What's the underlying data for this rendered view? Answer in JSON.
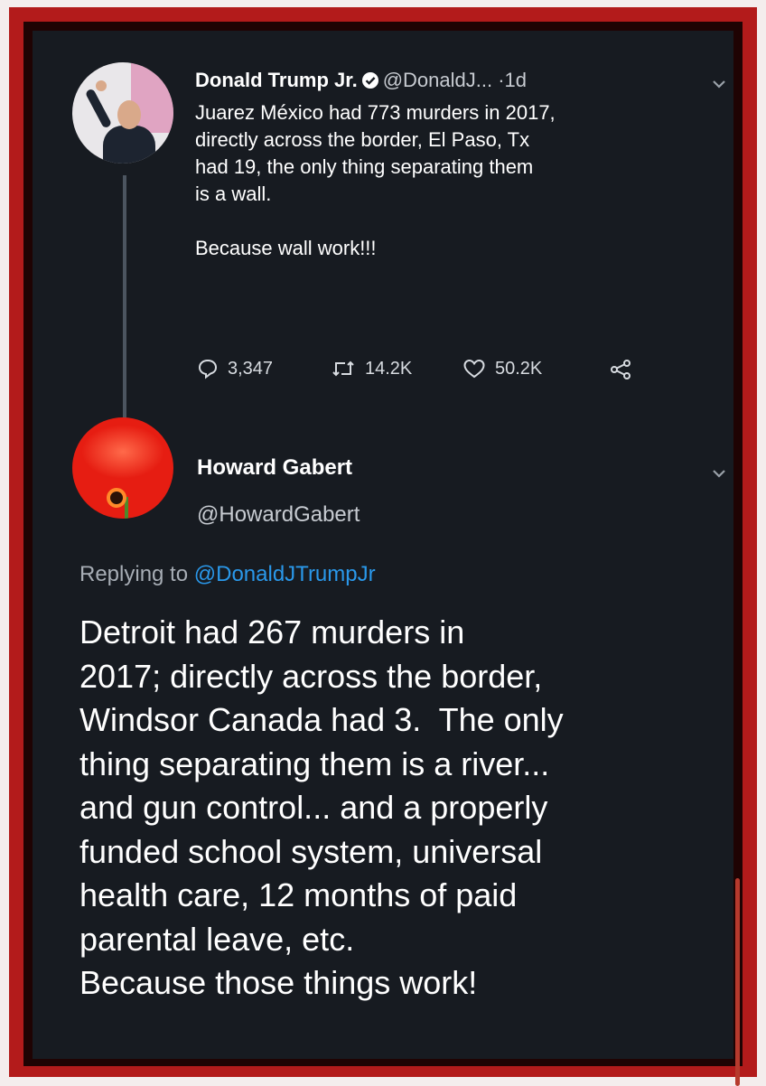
{
  "tweet1": {
    "name": "Donald Trump Jr.",
    "handle": "@DonaldJ...",
    "dot": "·",
    "time": "1d",
    "lines": [
      "Juarez México had 773 murders in 2017,",
      "directly across the border, El Paso, Tx",
      "had 19, the only thing separating them",
      "is a wall."
    ],
    "second_paragraph": "Because wall work!!!",
    "replies": "3,347",
    "retweets": "14.2K",
    "likes": "50.2K"
  },
  "tweet2": {
    "name": "Howard Gabert",
    "handle": "@HowardGabert",
    "replying_prefix": "Replying to",
    "replying_mention": "@DonaldJTrumpJr",
    "lines": [
      "Detroit had 267 murders in",
      "2017; directly across the border,",
      "Windsor Canada had 3.  The only",
      "thing separating them is a river...",
      "and gun control... and a properly",
      "funded school system, universal",
      "health care, 12 months of paid",
      "parental leave, etc.",
      "Because those things work!"
    ]
  },
  "colors": {
    "background": "#171b21",
    "frame": "#b31b1b",
    "link": "#2a98ea",
    "text": "#ffffff",
    "muted": "#c7cbd1"
  },
  "icons": [
    "verified-badge-icon",
    "chevron-down-icon",
    "reply-icon",
    "retweet-icon",
    "like-icon",
    "share-icon"
  ]
}
